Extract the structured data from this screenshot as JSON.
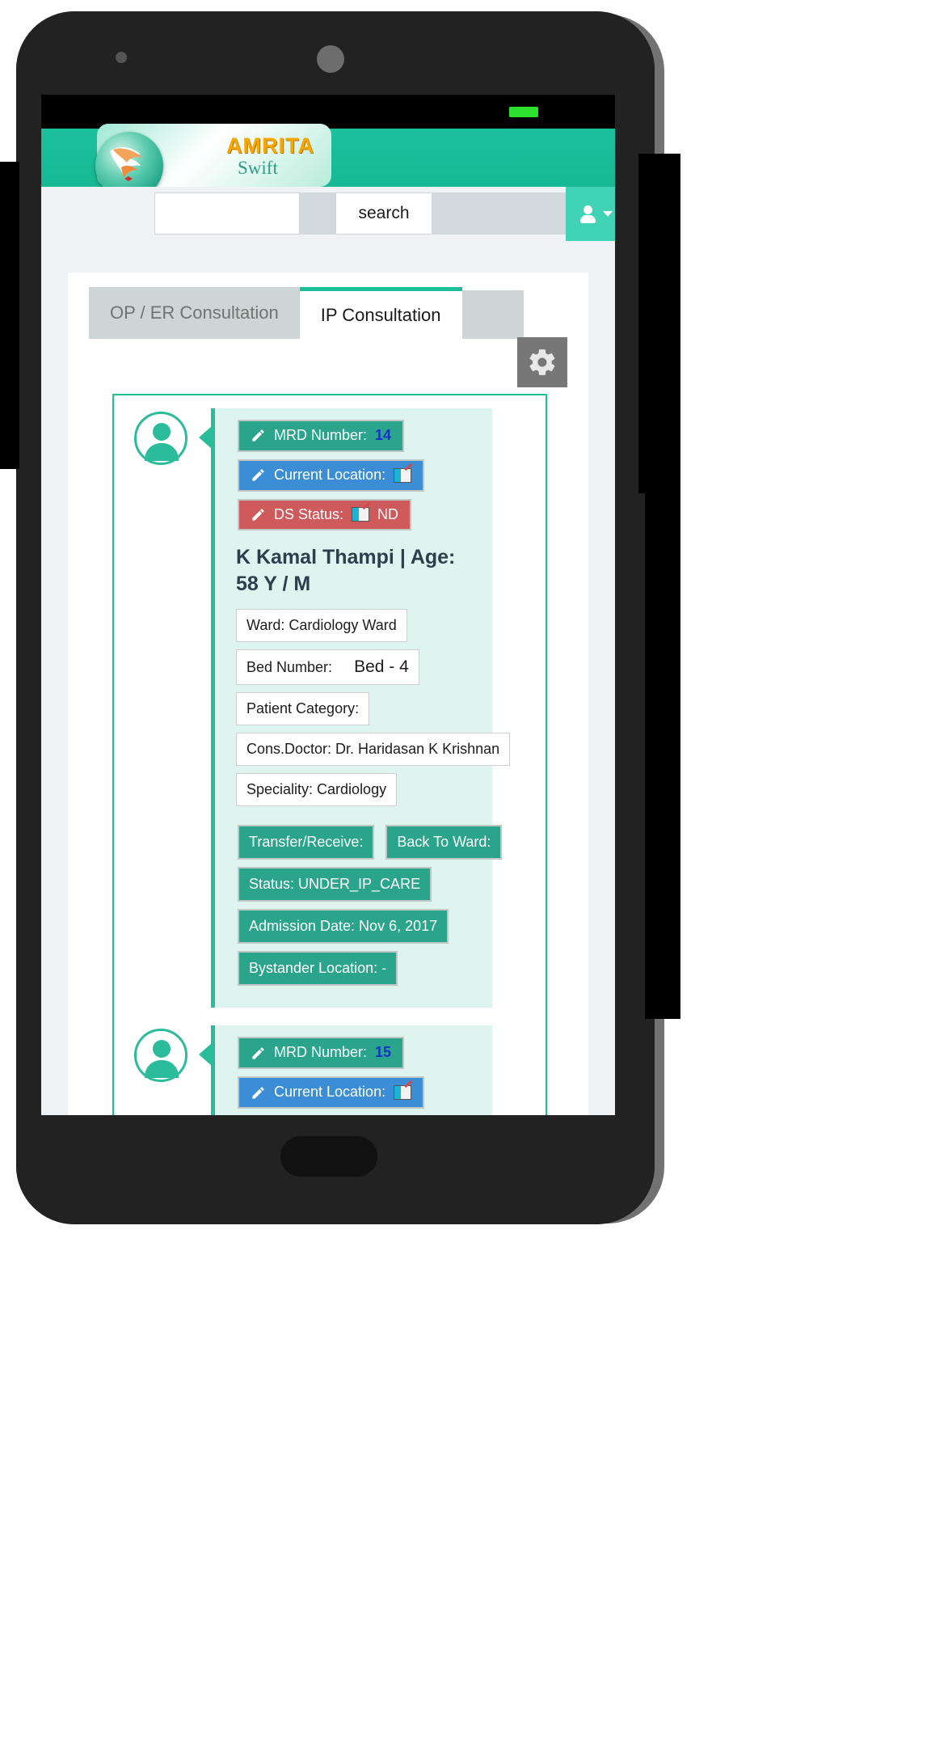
{
  "brand": {
    "name": "AMRITA",
    "subtitle": "Swift"
  },
  "search": {
    "value": "",
    "placeholder": "",
    "button_label": "search"
  },
  "account": {
    "icon": "user-icon",
    "caret": "chevron-down-icon"
  },
  "tabs": [
    {
      "label": "OP / ER Consultation",
      "active": false
    },
    {
      "label": "IP Consultation",
      "active": true
    }
  ],
  "toolbar": {
    "settings_icon": "gear-icon"
  },
  "patients": [
    {
      "mrd_label": "MRD Number:",
      "mrd_value": "14",
      "location_label": "Current Location:",
      "location_value": "",
      "ds_label": "DS Status:",
      "ds_value": "ND",
      "name_line": "K Kamal Thampi | Age: 58 Y / M",
      "ward": "Ward: Cardiology Ward",
      "bed_label": "Bed Number:",
      "bed_value": "Bed - 4",
      "category": "Patient Category:",
      "doctor": "Cons.Doctor: Dr. Haridasan K Krishnan",
      "speciality": "Speciality: Cardiology",
      "transfer": "Transfer/Receive:",
      "back_to_ward": "Back To Ward:",
      "status": "Status: UNDER_IP_CARE",
      "admission": "Admission Date: Nov 6, 2017",
      "bystander": "Bystander Location:",
      "bystander_value": "-"
    },
    {
      "mrd_label": "MRD Number:",
      "mrd_value": "15",
      "location_label": "Current Location:",
      "location_value": ""
    }
  ],
  "colors": {
    "brand_teal": "#1cbf9c",
    "badge_teal": "#2aa58c",
    "badge_blue": "#3b8ed5",
    "badge_red": "#cf5a5c",
    "card_bg": "#ddf5ee",
    "logo_gold": "#f6a800"
  }
}
